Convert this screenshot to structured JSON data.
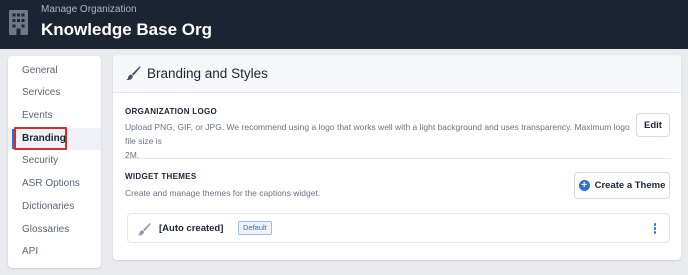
{
  "header": {
    "subtitle": "Manage Organization",
    "title": "Knowledge Base Org"
  },
  "sidebar": {
    "items": [
      {
        "label": "General"
      },
      {
        "label": "Services"
      },
      {
        "label": "Events"
      },
      {
        "label": "Branding",
        "active": true
      },
      {
        "label": "Security"
      },
      {
        "label": "ASR Options"
      },
      {
        "label": "Dictionaries"
      },
      {
        "label": "Glossaries"
      },
      {
        "label": "API"
      }
    ]
  },
  "main": {
    "title": "Branding and Styles",
    "logo_section": {
      "title": "ORGANIZATION LOGO",
      "description_line1": "Upload PNG, GIF, or JPG. We recommend using a logo that works well with a light background and uses transparency. Maximum logo file size is",
      "description_line2": "2M.",
      "edit_label": "Edit"
    },
    "themes_section": {
      "title": "WIDGET THEMES",
      "description": "Create and manage themes for the captions widget.",
      "create_label": "Create a Theme",
      "themes": [
        {
          "name": "[Auto created]",
          "badge": "Default"
        }
      ]
    }
  },
  "colors": {
    "header_bg": "#1c2433",
    "accent": "#2f6fda",
    "highlight": "#d62c2c"
  }
}
